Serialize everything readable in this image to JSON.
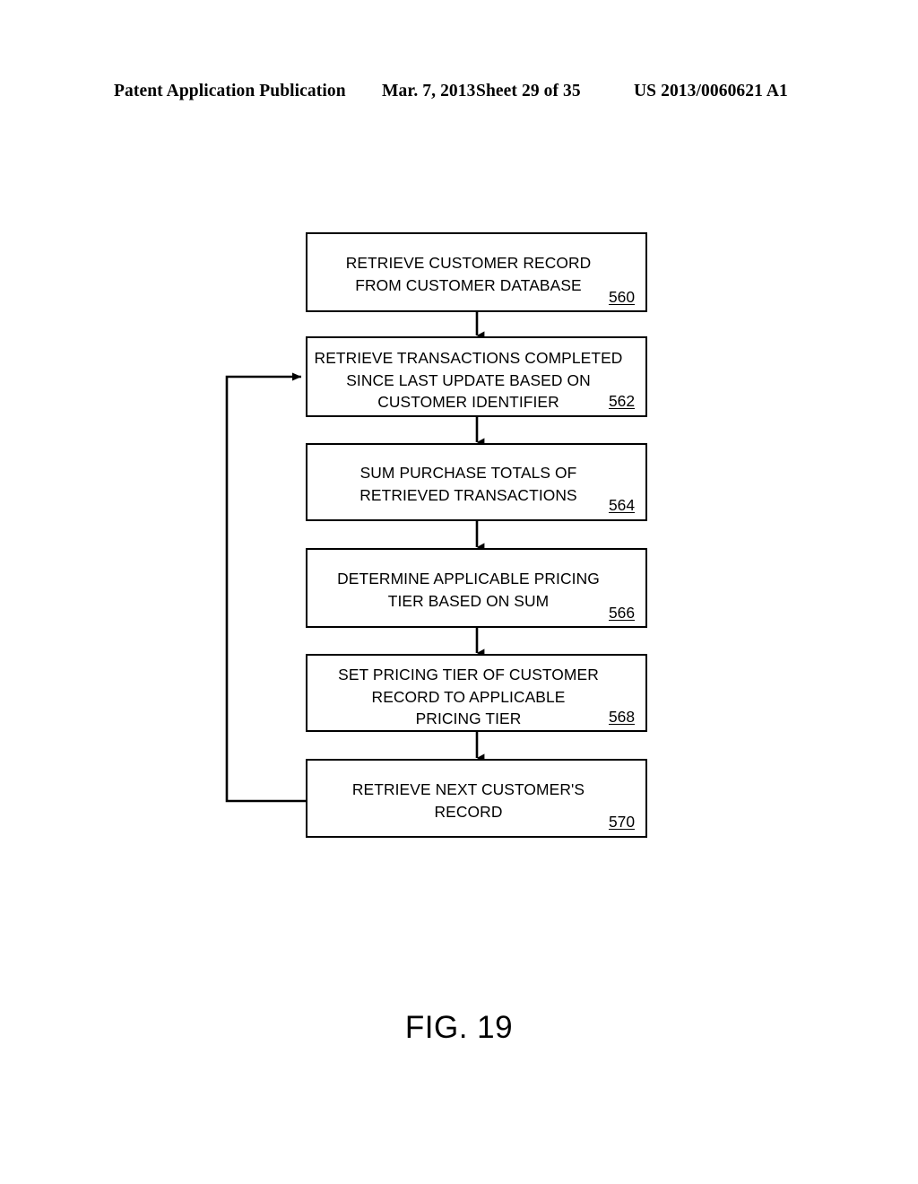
{
  "header": {
    "publication_type": "Patent Application Publication",
    "date": "Mar. 7, 2013",
    "sheet": "Sheet 29 of 35",
    "publication_number": "US 2013/0060621 A1"
  },
  "figure": {
    "caption": "FIG. 19",
    "line_color": "#000000",
    "background_color": "#ffffff"
  },
  "flowchart": {
    "type": "process-flow",
    "steps": [
      {
        "ref": "560",
        "text": "RETRIEVE CUSTOMER RECORD\nFROM CUSTOMER DATABASE"
      },
      {
        "ref": "562",
        "text": "RETRIEVE TRANSACTIONS COMPLETED\nSINCE LAST UPDATE BASED ON\nCUSTOMER IDENTIFIER"
      },
      {
        "ref": "564",
        "text": "SUM PURCHASE TOTALS OF\nRETRIEVED TRANSACTIONS"
      },
      {
        "ref": "566",
        "text": "DETERMINE APPLICABLE PRICING\nTIER BASED ON SUM"
      },
      {
        "ref": "568",
        "text": "SET PRICING TIER OF CUSTOMER\nRECORD TO APPLICABLE\nPRICING TIER"
      },
      {
        "ref": "570",
        "text": "RETRIEVE NEXT CUSTOMER'S\nRECORD"
      }
    ],
    "connectors": [
      {
        "from": "560",
        "to": "562",
        "style": "arrow-down"
      },
      {
        "from": "562",
        "to": "564",
        "style": "arrow-down"
      },
      {
        "from": "564",
        "to": "566",
        "style": "arrow-down"
      },
      {
        "from": "566",
        "to": "568",
        "style": "arrow-down"
      },
      {
        "from": "568",
        "to": "570",
        "style": "arrow-down"
      },
      {
        "from": "570",
        "to": "562",
        "style": "feedback-loop-left"
      }
    ]
  }
}
